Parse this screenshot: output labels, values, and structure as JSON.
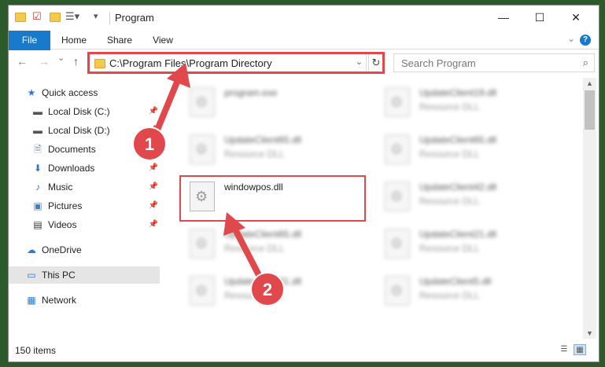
{
  "window": {
    "title": "Program"
  },
  "ribbon": {
    "tabs": [
      "File",
      "Home",
      "Share",
      "View"
    ],
    "help": "?"
  },
  "nav": {
    "back": "←",
    "forward": "→",
    "recent": "⌄",
    "up": "↑",
    "address": "C:\\Program Files\\Program Directory",
    "search_placeholder": "Search Program"
  },
  "sidebar": {
    "items": [
      {
        "label": "Quick access",
        "icon": "star-icon",
        "pinned": false
      },
      {
        "label": "Local Disk (C:)",
        "icon": "drive-icon",
        "pinned": true
      },
      {
        "label": "Local Disk (D:)",
        "icon": "drive-icon",
        "pinned": true
      },
      {
        "label": "Documents",
        "icon": "document-icon",
        "pinned": true
      },
      {
        "label": "Downloads",
        "icon": "download-icon",
        "pinned": true
      },
      {
        "label": "Music",
        "icon": "music-icon",
        "pinned": true
      },
      {
        "label": "Pictures",
        "icon": "picture-icon",
        "pinned": true
      },
      {
        "label": "Videos",
        "icon": "video-icon",
        "pinned": true
      },
      {
        "label": "OneDrive",
        "icon": "cloud-icon",
        "pinned": false
      },
      {
        "label": "This PC",
        "icon": "pc-icon",
        "pinned": false,
        "selected": true
      },
      {
        "label": "Network",
        "icon": "network-icon",
        "pinned": false
      }
    ]
  },
  "files": [
    {
      "name": "program.exe",
      "type": ""
    },
    {
      "name": "UpdateClient19.dll",
      "type": "Resource DLL"
    },
    {
      "name": "UpdateClient65.dll",
      "type": "Resource DLL"
    },
    {
      "name": "UpdateClient65.dll",
      "type": "Resource DLL"
    },
    {
      "name": "windowpos.dll",
      "type": ""
    },
    {
      "name": "UpdateClient42.dll",
      "type": "Resource DLL"
    },
    {
      "name": "UpdateClient65.dll",
      "type": "Resource DLL"
    },
    {
      "name": "UpdateClient21.dll",
      "type": "Resource DLL"
    },
    {
      "name": "UpdateClient31.dll",
      "type": "Resource DLL"
    },
    {
      "name": "UpdateClient5.dll",
      "type": "Resource DLL"
    }
  ],
  "status": {
    "item_count": "150 items"
  },
  "annotations": {
    "step1": "1",
    "step2": "2",
    "color": "#e0484c"
  }
}
